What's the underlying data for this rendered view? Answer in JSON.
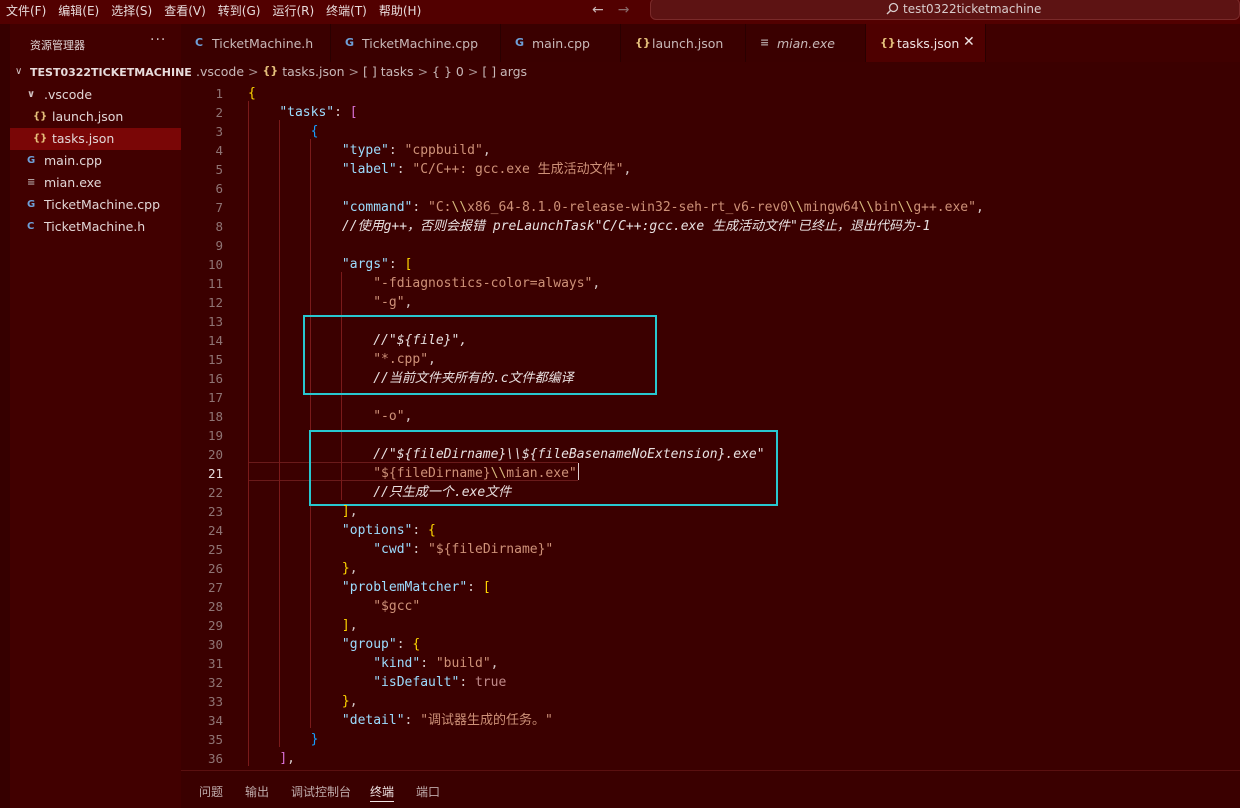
{
  "menu": [
    "文件(F)",
    "编辑(E)",
    "选择(S)",
    "查看(V)",
    "转到(G)",
    "运行(R)",
    "终端(T)",
    "帮助(H)"
  ],
  "nav": {
    "back": "←",
    "forward": "→"
  },
  "command_center": {
    "text": "test0322ticketmachine",
    "icon": "search-icon"
  },
  "sidebar": {
    "title": "资源管理器",
    "more": "···",
    "folder": "TEST0322TICKETMACHINE",
    "items": [
      {
        "label": ".vscode",
        "icon": "chevron-down-icon",
        "glyph": "∨"
      },
      {
        "label": "launch.json",
        "icon": "json-file-icon",
        "glyph": "{}"
      },
      {
        "label": "tasks.json",
        "icon": "json-file-icon",
        "glyph": "{}",
        "selected": true
      },
      {
        "label": "main.cpp",
        "icon": "cpp-file-icon",
        "glyph": "G"
      },
      {
        "label": "mian.exe",
        "icon": "exe-file-icon",
        "glyph": "≡"
      },
      {
        "label": "TicketMachine.cpp",
        "icon": "cpp-file-icon",
        "glyph": "G"
      },
      {
        "label": "TicketMachine.h",
        "icon": "header-file-icon",
        "glyph": "C"
      }
    ]
  },
  "tabs": [
    {
      "label": "TicketMachine.h",
      "icon": "header-file-icon",
      "glyph": "C"
    },
    {
      "label": "TicketMachine.cpp",
      "icon": "cpp-file-icon",
      "glyph": "G"
    },
    {
      "label": "main.cpp",
      "icon": "cpp-file-icon",
      "glyph": "G"
    },
    {
      "label": "launch.json",
      "icon": "json-file-icon",
      "glyph": "{}"
    },
    {
      "label": "mian.exe",
      "icon": "exe-file-icon",
      "glyph": "≡"
    },
    {
      "label": "tasks.json",
      "icon": "json-file-icon",
      "glyph": "{}",
      "active": true,
      "close": "✕"
    }
  ],
  "breadcrumb": {
    "folder": ".vscode",
    "file": "tasks.json",
    "file_glyph": "{}",
    "sep": ">",
    "p1": "[ ] tasks",
    "p2": "{ } 0",
    "p3": "[ ] args"
  },
  "editor": {
    "active_line": 21,
    "lines": [
      "{",
      "    \"tasks\": [",
      "        {",
      "            \"type\": \"cppbuild\",",
      "            \"label\": \"C/C++: gcc.exe 生成活动文件\",",
      "",
      "            \"command\": \"C:\\\\x86_64-8.1.0-release-win32-seh-rt_v6-rev0\\\\mingw64\\\\bin\\\\g++.exe\",",
      "            //使用g++，否则会报错 preLaunchTask\"C/C++:gcc.exe 生成活动文件\"已终止，退出代码为-1",
      "",
      "            \"args\": [",
      "                \"-fdiagnostics-color=always\",",
      "                \"-g\",",
      "",
      "                //\"${file}\",",
      "                \"*.cpp\",",
      "                //当前文件夹所有的.c文件都编译",
      "",
      "                \"-o\",",
      "",
      "                //\"${fileDirname}\\\\${fileBasenameNoExtension}.exe\"",
      "                \"${fileDirname}\\\\mian.exe\"",
      "                //只生成一个.exe文件",
      "            ],",
      "            \"options\": {",
      "                \"cwd\": \"${fileDirname}\"",
      "            },",
      "            \"problemMatcher\": [",
      "                \"$gcc\"",
      "            ],",
      "            \"group\": {",
      "                \"kind\": \"build\",",
      "                \"isDefault\": true",
      "            },",
      "            \"detail\": \"调试器生成的任务。\"",
      "        }",
      "    ],"
    ]
  },
  "panel": {
    "tabs": [
      "问题",
      "输出",
      "调试控制台",
      "终端",
      "端口"
    ],
    "active": "终端"
  },
  "colors": {
    "background": "#3b0000",
    "sidebar": "#410000",
    "selection": "#7a0606",
    "annotation_box": "#28c8d0"
  }
}
